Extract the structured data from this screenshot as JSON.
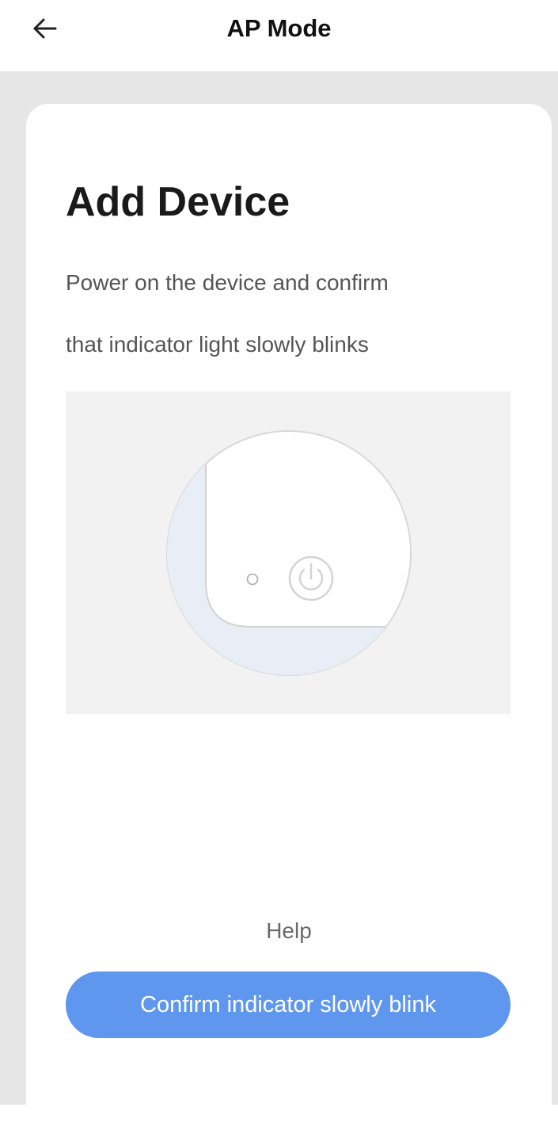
{
  "header": {
    "title": "AP Mode",
    "back_icon": "arrow-left-icon"
  },
  "card": {
    "title": "Add Device",
    "instruction_lines": [
      "Power on the device and confirm",
      "that indicator light slowly blinks"
    ],
    "illustration": {
      "indicator_icon": "indicator-light-icon",
      "power_icon": "power-icon"
    },
    "help_label": "Help",
    "confirm_label": "Confirm indicator slowly blink"
  },
  "colors": {
    "accent": "#5f97ee",
    "backdrop": "#e6e6e6",
    "card": "#ffffff",
    "illustration_bg": "#f2f2f2",
    "device_edge": "#e9eef6"
  }
}
